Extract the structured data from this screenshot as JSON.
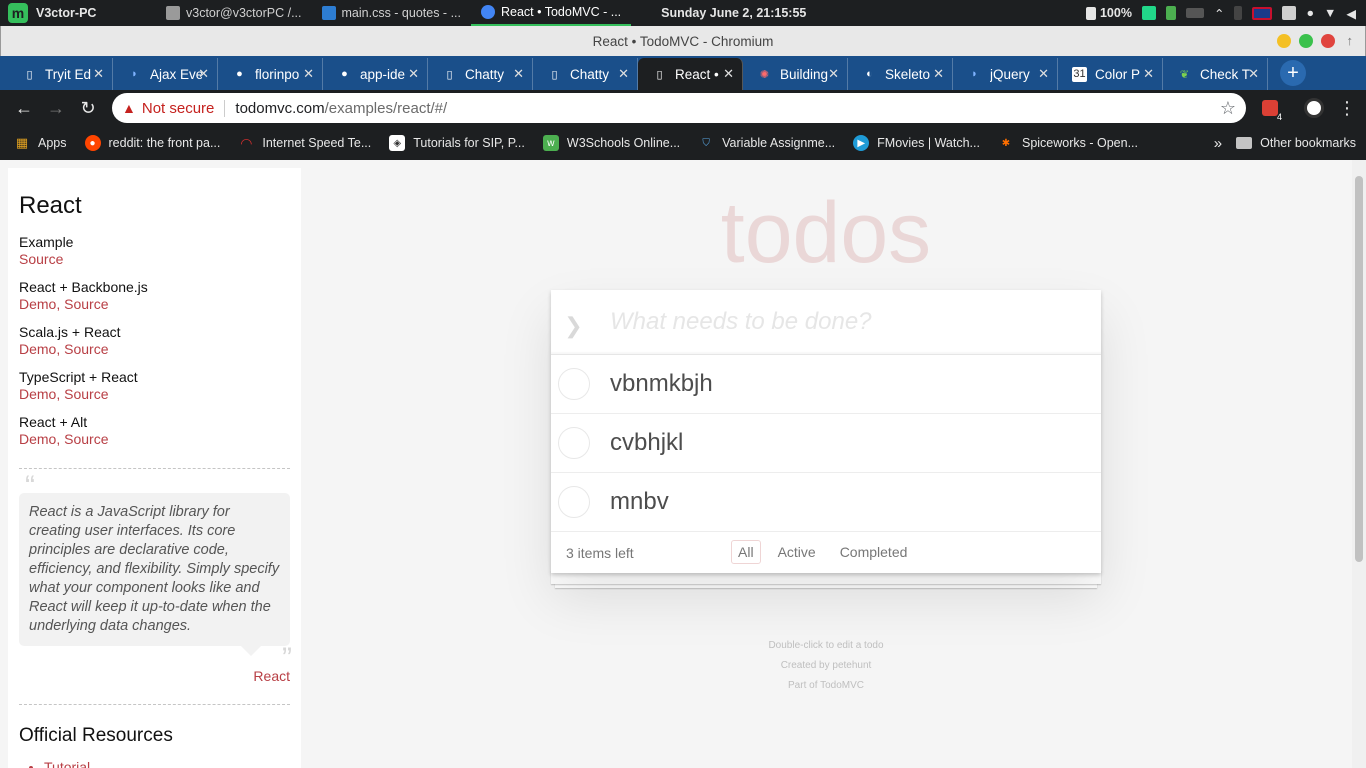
{
  "os": {
    "brand": "V3ctor-PC",
    "tasks": [
      {
        "label": "v3ctor@v3ctorPC /...",
        "color": "#9a9a9a",
        "active": false
      },
      {
        "label": "main.css - quotes - ...",
        "color": "#2d7dd2",
        "active": false
      },
      {
        "label": "React • TodoMVC - ...",
        "color": "#4285f4",
        "active": true
      }
    ],
    "clock": "Sunday June  2, 21:15:55",
    "battery": "100%"
  },
  "window": {
    "title": "React • TodoMVC - Chromium"
  },
  "tabs": [
    {
      "title": "Tryit Ed",
      "icon": "document-icon",
      "active": false
    },
    {
      "title": "Ajax Eve",
      "icon": "ide-icon",
      "active": false
    },
    {
      "title": "florinpo",
      "icon": "github-icon",
      "active": false
    },
    {
      "title": "app-ide",
      "icon": "github-icon",
      "active": false
    },
    {
      "title": "Chatty",
      "icon": "document-icon",
      "active": false
    },
    {
      "title": "Chatty",
      "icon": "document-icon",
      "active": false
    },
    {
      "title": "React •",
      "icon": "document-icon",
      "active": true
    },
    {
      "title": "Building",
      "icon": "gear-icon",
      "active": false
    },
    {
      "title": "Skeleto",
      "icon": "circle-icon",
      "active": false
    },
    {
      "title": "jQuery",
      "icon": "ide-icon",
      "active": false
    },
    {
      "title": "Color P",
      "icon": "calendar-icon",
      "active": false
    },
    {
      "title": "Check T",
      "icon": "leaf-icon",
      "active": false
    }
  ],
  "omnibox": {
    "security": "Not secure",
    "host": "todomvc.com",
    "path": "/examples/react/#/"
  },
  "extensions": {
    "badge": "4"
  },
  "bookmarks": [
    {
      "label": "Apps",
      "icon": "apps-grid-icon",
      "color": "#e0a020"
    },
    {
      "label": "reddit: the front pa...",
      "icon": "reddit-icon",
      "color": "#ff4500"
    },
    {
      "label": "Internet Speed Te...",
      "icon": "speed-icon",
      "color": "#d32f2f"
    },
    {
      "label": "Tutorials for SIP, P...",
      "icon": "tutorial-icon",
      "color": "#ffffff"
    },
    {
      "label": "W3Schools Online...",
      "icon": "w3schools-icon",
      "color": "#4caf50"
    },
    {
      "label": "Variable Assignme...",
      "icon": "shield-icon",
      "color": "#5aa9e6"
    },
    {
      "label": "FMovies | Watch...",
      "icon": "play-icon",
      "color": "#1e9bd7"
    },
    {
      "label": "Spiceworks - Open...",
      "icon": "spice-icon",
      "color": "#ff6f00"
    }
  ],
  "other_bookmarks": "Other bookmarks",
  "sidebar": {
    "title": "React",
    "examples": [
      {
        "name": "Example",
        "links": "Source"
      },
      {
        "name": "React + Backbone.js",
        "links": "Demo, Source"
      },
      {
        "name": "Scala.js + React",
        "links": "Demo, Source"
      },
      {
        "name": "TypeScript + React",
        "links": "Demo, Source"
      },
      {
        "name": "React + Alt",
        "links": "Demo, Source"
      }
    ],
    "quote": "React is a JavaScript library for creating user interfaces. Its core principles are declarative code, efficiency, and flexibility. Simply specify what your component looks like and React will keep it up-to-date when the underlying data changes.",
    "quote_author": "React",
    "resources_title": "Official Resources",
    "resources": [
      "Tutorial"
    ]
  },
  "todoapp": {
    "title": "todos",
    "placeholder": "What needs to be done?",
    "items": [
      {
        "label": "vbnmkbjh"
      },
      {
        "label": "cvbhjkl"
      },
      {
        "label": "mnbv"
      }
    ],
    "items_left": "3 items left",
    "filters": [
      "All",
      "Active",
      "Completed"
    ],
    "selected_filter": "All"
  },
  "info": {
    "line1": "Double-click to edit a todo",
    "line2": "Created by petehunt",
    "line3": "Part of TodoMVC"
  }
}
